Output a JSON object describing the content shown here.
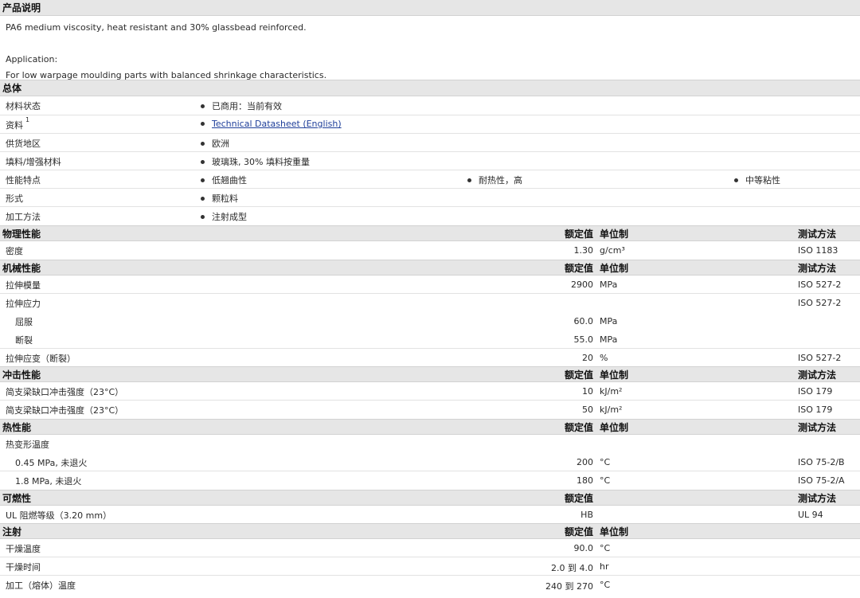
{
  "product_desc": {
    "title": "产品说明",
    "line1": "PA6 medium viscosity, heat resistant and 30% glassbead reinforced.",
    "line2": "Application:",
    "line3": "For low warpage moulding parts with balanced shrinkage characteristics."
  },
  "general": {
    "title": "总体",
    "rows": [
      {
        "label": "材料状态",
        "items": [
          "已商用：当前有效"
        ]
      },
      {
        "label": "资料",
        "sup": "1",
        "items": [
          "Technical Datasheet (English)"
        ]
      },
      {
        "label": "供货地区",
        "items": [
          "欧洲"
        ]
      },
      {
        "label": "填料/增强材料",
        "items": [
          "玻璃珠, 30% 填料按重量"
        ]
      },
      {
        "label": "性能特点",
        "items": [
          "低翘曲性",
          "耐热性，高",
          "中等粘性"
        ]
      },
      {
        "label": "形式",
        "items": [
          "颗粒料"
        ]
      },
      {
        "label": "加工方法",
        "items": [
          "注射成型"
        ]
      }
    ]
  },
  "headers": {
    "value": "额定值",
    "unit": "单位制",
    "method": "测试方法"
  },
  "physical": {
    "title": "物理性能",
    "rows": [
      {
        "label": "密度",
        "value": "1.30",
        "unit": "g/cm³",
        "method": "ISO 1183"
      }
    ]
  },
  "mechanical": {
    "title": "机械性能",
    "rows": [
      {
        "label": "拉伸模量",
        "value": "2900",
        "unit": "MPa",
        "method": "ISO 527-2"
      },
      {
        "label": "拉伸应力",
        "value": "",
        "unit": "",
        "method": "ISO 527-2"
      },
      {
        "label": "屈服",
        "value": "60.0",
        "unit": "MPa",
        "method": ""
      },
      {
        "label": "断裂",
        "value": "55.0",
        "unit": "MPa",
        "method": ""
      },
      {
        "label": "拉伸应变（断裂）",
        "value": "20",
        "unit": "%",
        "method": "ISO 527-2"
      }
    ]
  },
  "impact": {
    "title": "冲击性能",
    "rows": [
      {
        "label": "简支梁缺口冲击强度（23°C）",
        "value": "10",
        "unit": "kJ/m²",
        "method": "ISO 179"
      },
      {
        "label": "简支梁缺口冲击强度（23°C）",
        "value": "50",
        "unit": "kJ/m²",
        "method": "ISO 179"
      }
    ]
  },
  "thermal": {
    "title": "热性能",
    "rows": [
      {
        "label": "热变形温度",
        "value": "",
        "unit": "",
        "method": ""
      },
      {
        "label": "0.45 MPa, 未退火",
        "value": "200",
        "unit": "°C",
        "method": "ISO 75-2/B"
      },
      {
        "label": "1.8 MPa, 未退火",
        "value": "180",
        "unit": "°C",
        "method": "ISO 75-2/A"
      }
    ]
  },
  "flammability": {
    "title": "可燃性",
    "rows": [
      {
        "label": "UL 阻燃等级（3.20 mm）",
        "value": "HB",
        "unit": "",
        "method": "UL 94"
      }
    ]
  },
  "injection": {
    "title": "注射",
    "rows": [
      {
        "label": "干燥温度",
        "value": "90.0",
        "unit": "°C",
        "method": ""
      },
      {
        "label": "干燥时间",
        "value": "2.0 到  4.0",
        "unit": "hr",
        "method": ""
      },
      {
        "label": "加工（熔体）温度",
        "value": "240 到  270",
        "unit": "°C",
        "method": ""
      }
    ]
  }
}
